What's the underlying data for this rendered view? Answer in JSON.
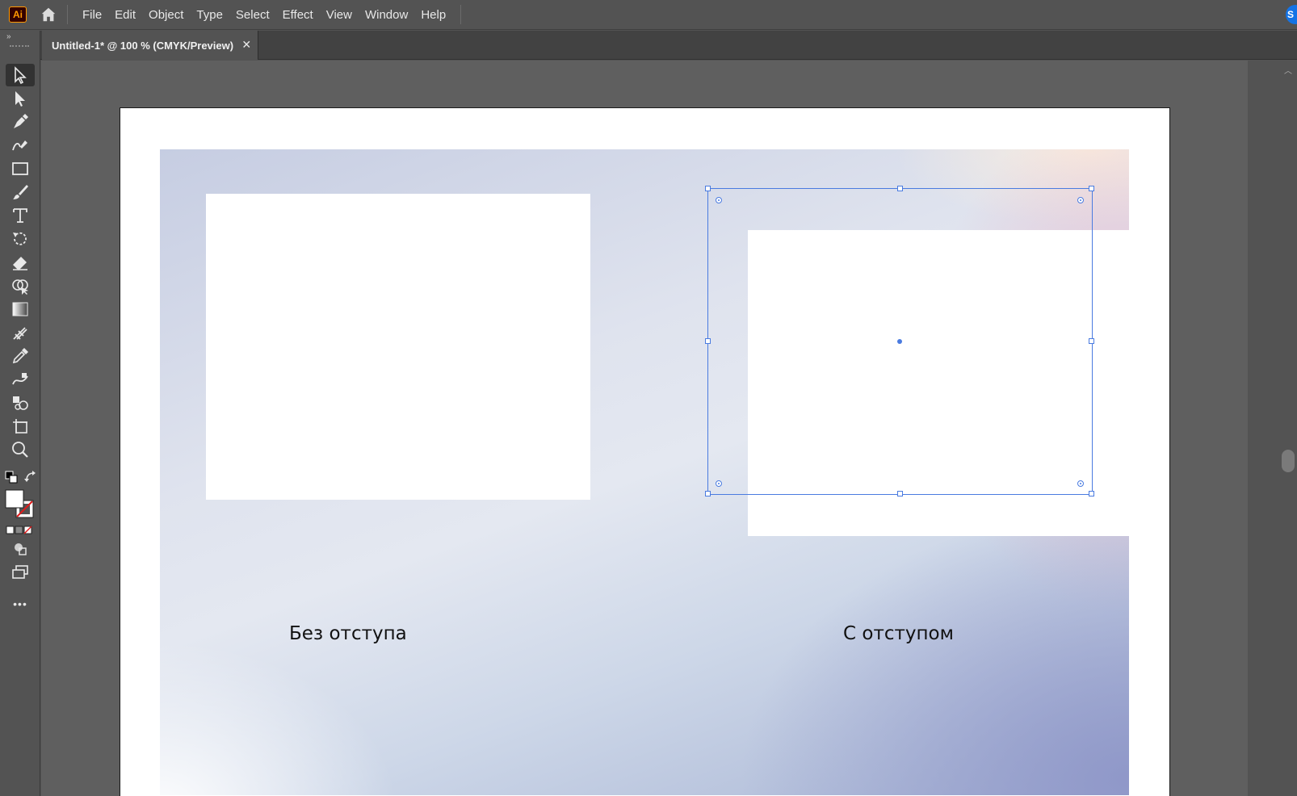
{
  "app": {
    "logo_text": "Ai",
    "menu": [
      "File",
      "Edit",
      "Object",
      "Type",
      "Select",
      "Effect",
      "View",
      "Window",
      "Help"
    ],
    "account_initial": "S"
  },
  "document": {
    "tab_title": "Untitled-1* @ 100 % (CMYK/Preview)",
    "close_glyph": "✕"
  },
  "toolbar": {
    "tools": [
      "selection-tool",
      "direct-selection-tool",
      "pen-tool",
      "curvature-tool",
      "rectangle-tool",
      "paintbrush-tool",
      "type-tool",
      "rotate-tool",
      "eraser-tool",
      "shape-builder-tool",
      "gradient-tool",
      "mesh-tool",
      "eyedropper-tool",
      "blend-tool",
      "symbol-sprayer-tool",
      "artboard-tool",
      "zoom-tool"
    ],
    "active_tool": "selection-tool",
    "fill_color": "#ffffff",
    "stroke": "none",
    "more_glyph": "•••"
  },
  "artboard": {
    "caption_left": "Без отступа",
    "caption_right": "С отступом"
  },
  "colors": {
    "selection": "#4a7be0",
    "ui_bg": "#535353",
    "pasteboard": "#5f5f5f"
  }
}
